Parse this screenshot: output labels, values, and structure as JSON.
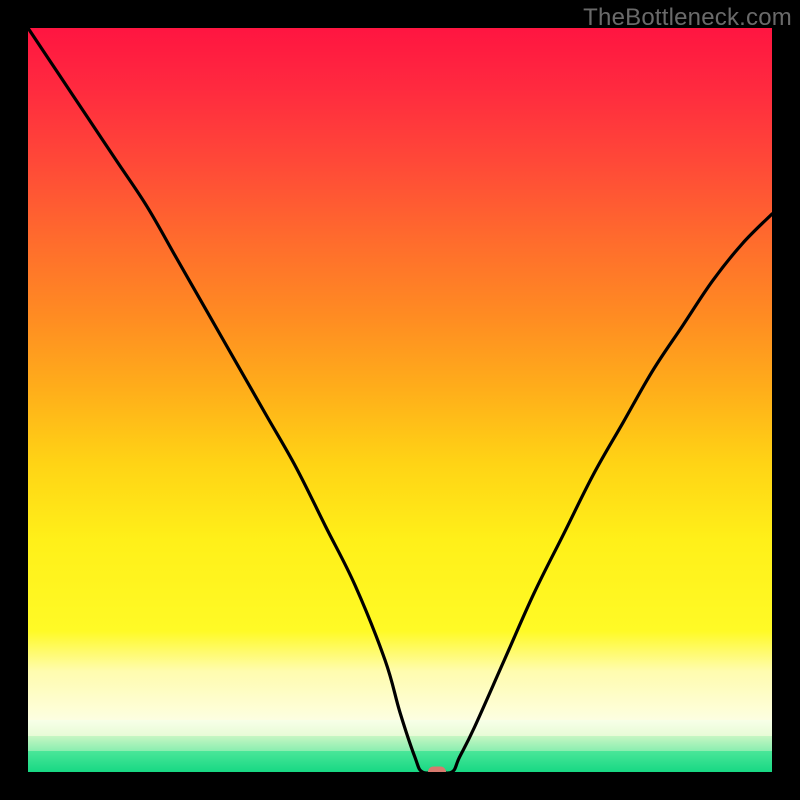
{
  "watermark": "TheBottleneck.com",
  "chart_data": {
    "type": "line",
    "title": "",
    "xlabel": "",
    "ylabel": "",
    "xlim": [
      0,
      100
    ],
    "ylim": [
      0,
      100
    ],
    "grid": false,
    "series": [
      {
        "name": "bottleneck-curve",
        "x": [
          0,
          4,
          8,
          12,
          16,
          20,
          24,
          28,
          32,
          36,
          40,
          44,
          48,
          50,
          52,
          53,
          55,
          57,
          58,
          60,
          64,
          68,
          72,
          76,
          80,
          84,
          88,
          92,
          96,
          100
        ],
        "y": [
          100,
          94,
          88,
          82,
          76,
          69,
          62,
          55,
          48,
          41,
          33,
          25,
          15,
          8,
          2,
          0,
          0,
          0,
          2,
          6,
          15,
          24,
          32,
          40,
          47,
          54,
          60,
          66,
          71,
          75
        ]
      }
    ],
    "marker": {
      "x": 55,
      "y": 0,
      "color": "#d77a6e"
    },
    "background_gradient": {
      "stops": [
        {
          "pos": 0.0,
          "color": "#ff1541"
        },
        {
          "pos": 0.35,
          "color": "#ff6b2d"
        },
        {
          "pos": 0.7,
          "color": "#ffd315"
        },
        {
          "pos": 0.88,
          "color": "#fffcae"
        },
        {
          "pos": 0.95,
          "color": "#c6f6c3"
        },
        {
          "pos": 1.0,
          "color": "#17d884"
        }
      ]
    }
  }
}
